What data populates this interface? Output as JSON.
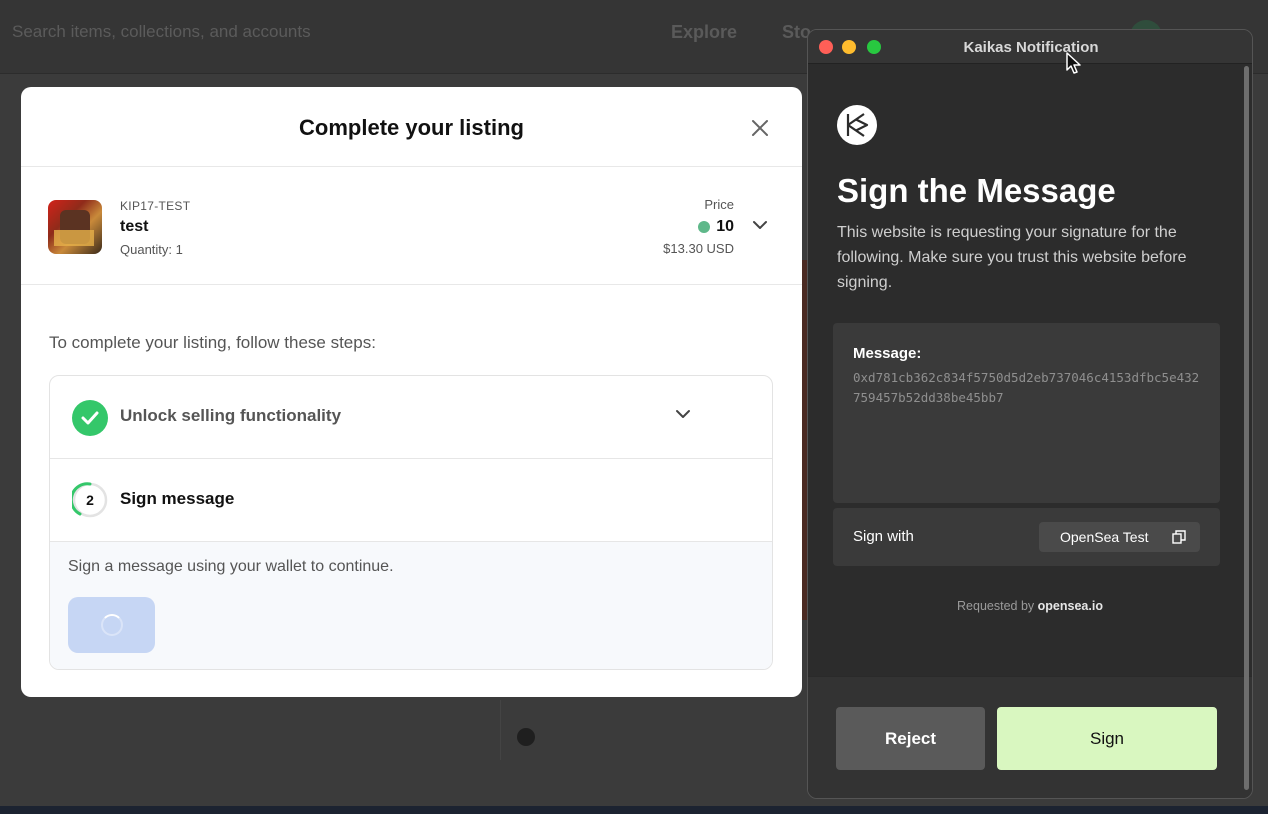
{
  "background": {
    "search_placeholder": "Search items, collections, and accounts",
    "nav_explore": "Explore",
    "nav_stats": "Sto"
  },
  "listing_modal": {
    "title": "Complete your listing",
    "item": {
      "collection": "KIP17-TEST",
      "name": "test",
      "quantity": "Quantity: 1",
      "price_label": "Price",
      "price_value": "10",
      "price_usd": "$13.30 USD"
    },
    "steps_intro": "To complete your listing, follow these steps:",
    "steps": [
      {
        "label": "Unlock selling functionality",
        "status": "complete"
      },
      {
        "number": "2",
        "label": "Sign message",
        "status": "in-progress"
      }
    ],
    "step_hint": "Sign a message using your wallet to continue."
  },
  "kaikas_window": {
    "window_title": "Kaikas Notification",
    "heading": "Sign the Message",
    "description": "This website is requesting your signature for the following. Make sure you trust this website before signing.",
    "message_label": "Message:",
    "message_value": "0xd781cb362c834f5750d5d2eb737046c4153dfbc5e432759457b52dd38be45bb7",
    "sign_with_label": "Sign with",
    "account_name": "OpenSea Test",
    "requested_by_prefix": "Requested by",
    "requested_by_domain": "opensea.io",
    "reject_label": "Reject",
    "sign_label": "Sign"
  },
  "colors": {
    "check_green": "#34c76a",
    "sign_button": "#d9f7c0",
    "loading_button": "#c6d6f4",
    "klay_token": "#5fb88a"
  }
}
